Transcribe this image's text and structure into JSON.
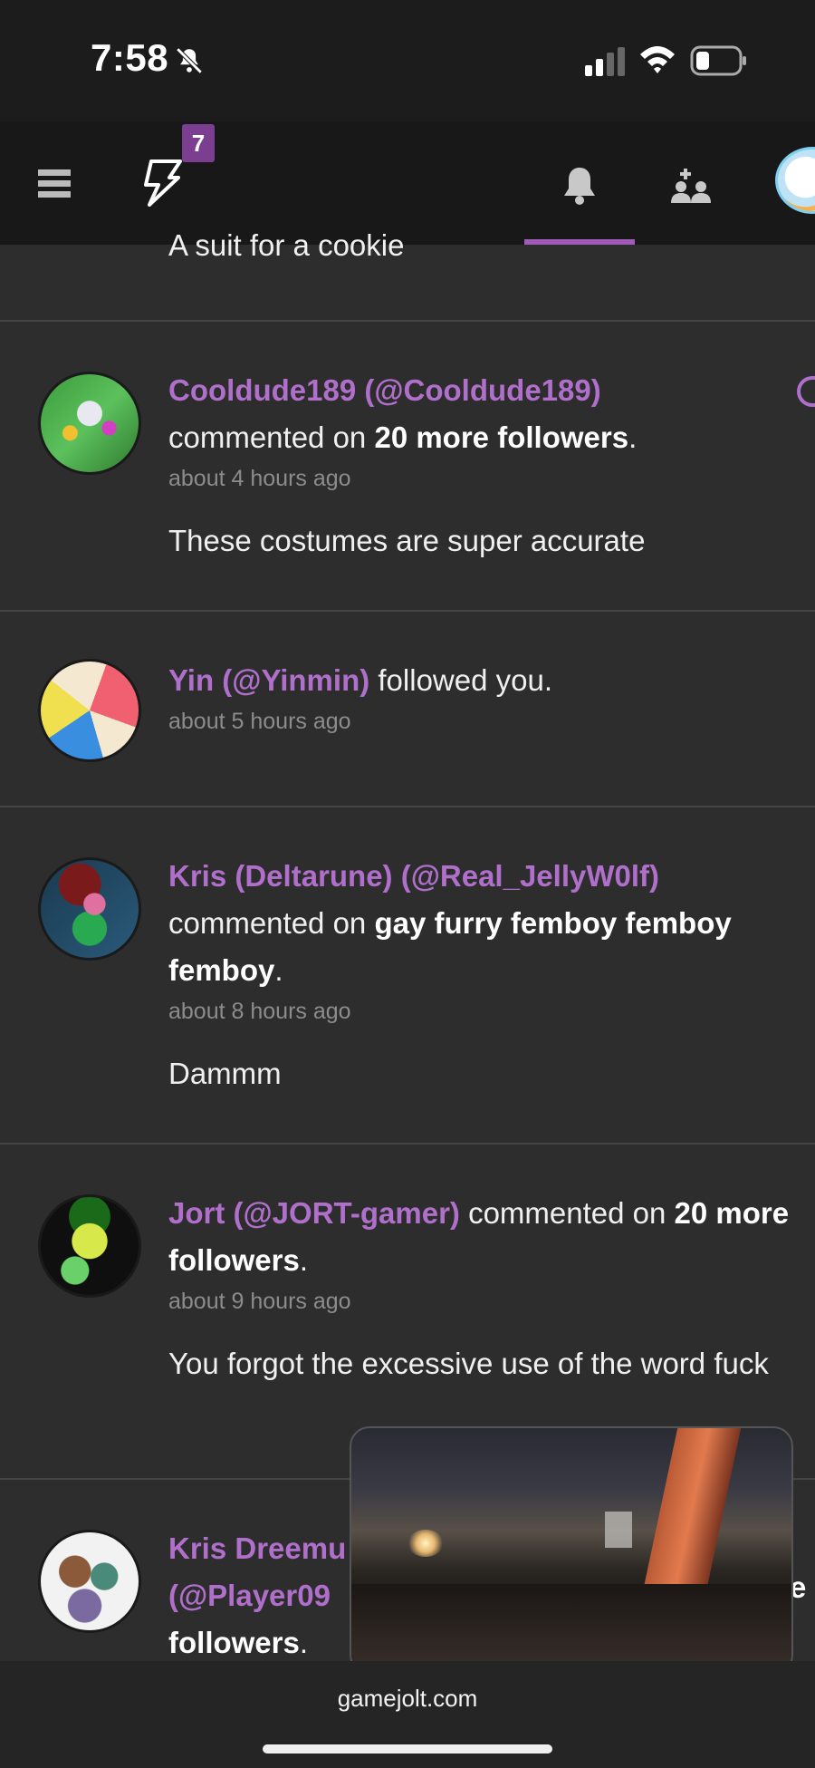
{
  "status": {
    "time": "7:58"
  },
  "nav": {
    "badge_count": "7"
  },
  "feed": {
    "truncated_text": "A suit for a cookie",
    "items": [
      {
        "user": "Cooldude189 (@Cooldude189)",
        "action": "commented on",
        "target": "20 more followers",
        "time": "about 4 hours ago",
        "comment": "These costumes are super accurate"
      },
      {
        "user": "Yin (@Yinmin)",
        "action": "followed you.",
        "time": "about 5 hours ago"
      },
      {
        "user": "Kris (Deltarune) (@Real_JellyW0lf)",
        "action": "commented on",
        "target": "gay furry femboy femboy femboy",
        "time": "about 8 hours ago",
        "comment": "Dammm"
      },
      {
        "user": "Jort (@JORT-gamer)",
        "action": "commented on",
        "target": "20 more followers",
        "time": "about 9 hours ago",
        "comment": "You forgot the excessive use of the word fuck"
      },
      {
        "user_line1": "Kris Dreemu",
        "user_line2": "(@Player09",
        "trailing": "e",
        "target_tail": "followers"
      }
    ]
  },
  "browser": {
    "url": "gamejolt.com"
  }
}
